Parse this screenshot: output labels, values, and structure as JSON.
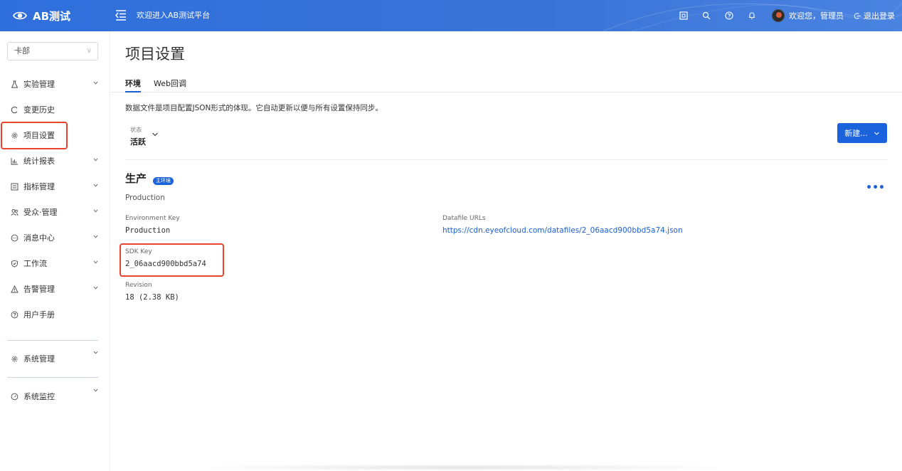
{
  "header": {
    "app_name": "AB测试",
    "welcome": "欢迎进入AB测试平台",
    "user_greeting": "欢迎您，管理员",
    "logout_label": "退出登录"
  },
  "sidebar": {
    "org_select": "卡部",
    "items": [
      {
        "label": "实验管理",
        "icon": "flask-icon"
      },
      {
        "label": "变更历史",
        "icon": "history-icon"
      },
      {
        "label": "项目设置",
        "icon": "gear-icon"
      },
      {
        "label": "统计报表",
        "icon": "chart-icon"
      },
      {
        "label": "指标管理",
        "icon": "metric-icon"
      },
      {
        "label": "受众·管理",
        "icon": "audience-icon"
      },
      {
        "label": "消息中心",
        "icon": "message-icon"
      },
      {
        "label": "工作流",
        "icon": "shield-icon"
      },
      {
        "label": "告警管理",
        "icon": "warning-icon"
      },
      {
        "label": "用户手册",
        "icon": "help-icon"
      },
      {
        "label": "系统管理",
        "icon": "gear-icon"
      },
      {
        "label": "系统监控",
        "icon": "gauge-icon"
      }
    ]
  },
  "main": {
    "title": "项目设置",
    "tabs": [
      {
        "label": "环境"
      },
      {
        "label": "Web回调"
      }
    ],
    "description": "数据文件是项目配置JSON形式的体现。它自动更新以便与所有设置保持同步。",
    "status": {
      "label": "状态",
      "value": "活跃"
    },
    "new_button": "新建...",
    "environment": {
      "name": "生产",
      "badge": "主环境",
      "subtitle": "Production",
      "env_key_label": "Environment Key",
      "env_key_value": "Production",
      "sdk_key_label": "SDK Key",
      "sdk_key_value": "2_06aacd900bbd5a74",
      "revision_label": "Revision",
      "revision_value": "18 (2.38 KB)",
      "datafile_label": "Datafile URLs",
      "datafile_url": "https://cdn.eyeofcloud.com/datafiles/2_06aacd900bbd5a74.json",
      "more": "•••"
    }
  },
  "colors": {
    "primary": "#1a63dd",
    "highlight": "#e8432c",
    "header_bg": "#2f6fdc"
  }
}
